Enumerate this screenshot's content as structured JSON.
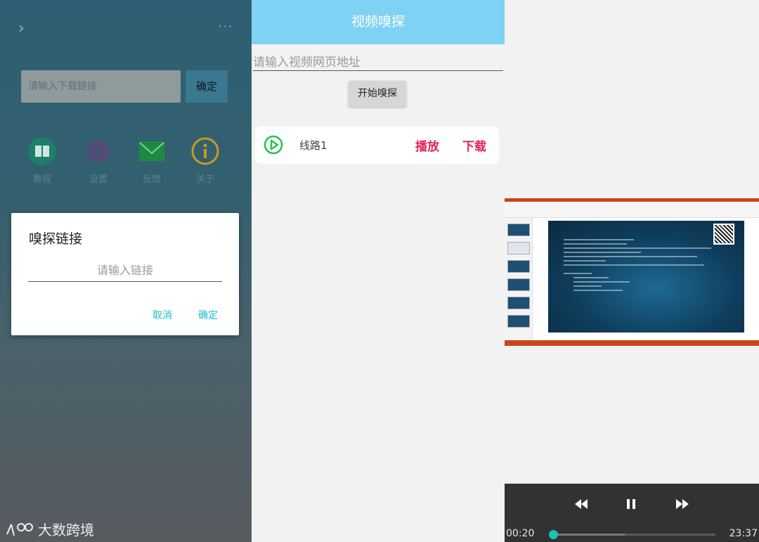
{
  "panel1": {
    "download_input_placeholder": "请输入下载链接",
    "confirm_label": "确定",
    "menu": [
      {
        "label": "教程",
        "icon": "book-icon",
        "color": "#1b7f6c"
      },
      {
        "label": "设置",
        "icon": "gear-icon",
        "color": "#6a3f7e"
      },
      {
        "label": "反馈",
        "icon": "mail-icon",
        "color": "#1d8a43"
      },
      {
        "label": "关于",
        "icon": "info-icon",
        "color": "#c89a1f"
      }
    ],
    "dialog": {
      "title": "嗅探链接",
      "input_placeholder": "请输入链接",
      "cancel_label": "取消",
      "confirm_label": "确定"
    },
    "watermark": "大数跨境"
  },
  "panel2": {
    "title": "视频嗅探",
    "url_placeholder": "请输入视频网页地址",
    "start_button": "开始嗅探",
    "result": {
      "name": "线路1",
      "play_label": "播放",
      "download_label": "下载"
    },
    "accent_color": "#e5245a",
    "header_color": "#80d2f5"
  },
  "panel3": {
    "player": {
      "current_time": "00:20",
      "duration": "23:37",
      "progress": 0.014,
      "buffered": 0.45
    }
  }
}
